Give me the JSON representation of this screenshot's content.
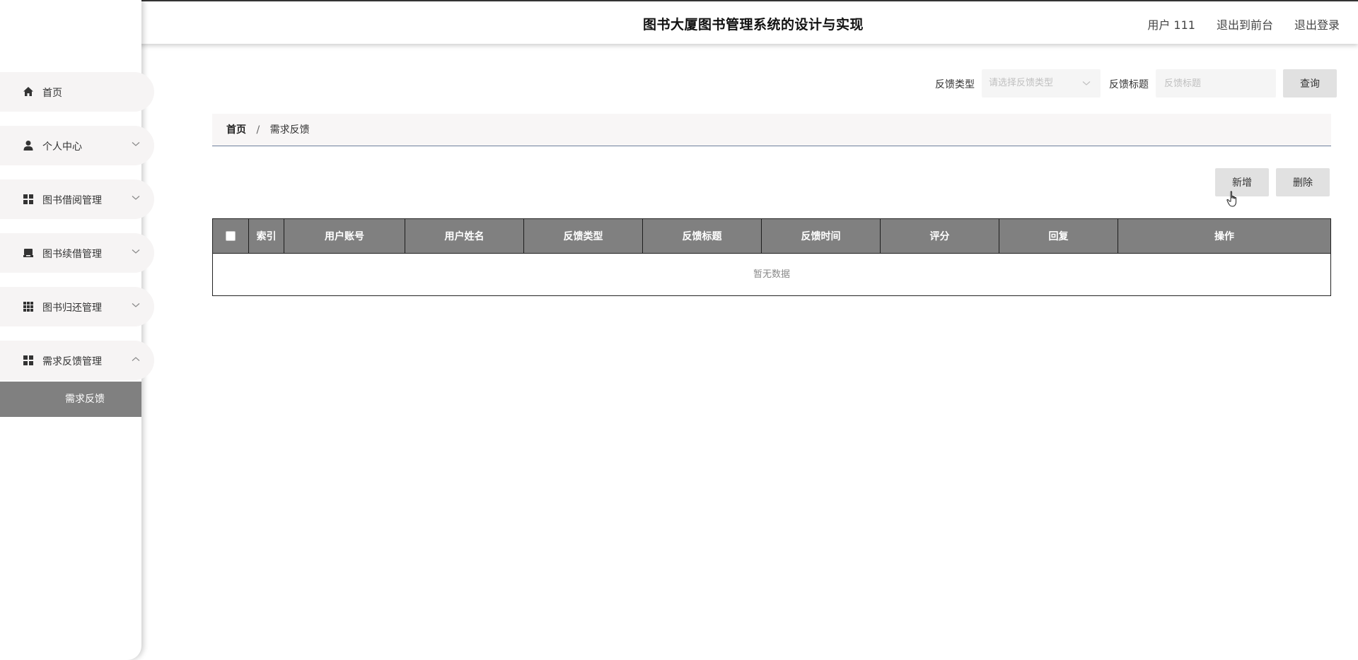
{
  "header": {
    "title": "图书大厦图书管理系统的设计与实现",
    "user_label": "用户 111",
    "to_front_label": "退出到前台",
    "logout_label": "退出登录"
  },
  "sidebar": {
    "items": [
      {
        "label": "首页",
        "icon": "home-icon"
      },
      {
        "label": "个人中心",
        "icon": "user-icon"
      },
      {
        "label": "图书借阅管理",
        "icon": "grid-icon"
      },
      {
        "label": "图书续借管理",
        "icon": "inbox-icon"
      },
      {
        "label": "图书归还管理",
        "icon": "apps-icon"
      },
      {
        "label": "需求反馈管理",
        "icon": "grid-icon"
      }
    ],
    "active_subitem": "需求反馈"
  },
  "search": {
    "type_label": "反馈类型",
    "type_placeholder": "请选择反馈类型",
    "title_label": "反馈标题",
    "title_placeholder": "反馈标题",
    "query_button": "查询"
  },
  "breadcrumb": {
    "home": "首页",
    "separator": "/",
    "current": "需求反馈"
  },
  "actions": {
    "add_label": "新增",
    "delete_label": "删除"
  },
  "table": {
    "columns": [
      "索引",
      "用户账号",
      "用户姓名",
      "反馈类型",
      "反馈标题",
      "反馈时间",
      "评分",
      "回复",
      "操作"
    ],
    "empty_text": "暂无数据"
  },
  "colors": {
    "header_bg": "#808080",
    "active_menu_bg": "#808080",
    "menu_bg": "#f6f4f4",
    "button_bg": "#e1e1e1"
  }
}
